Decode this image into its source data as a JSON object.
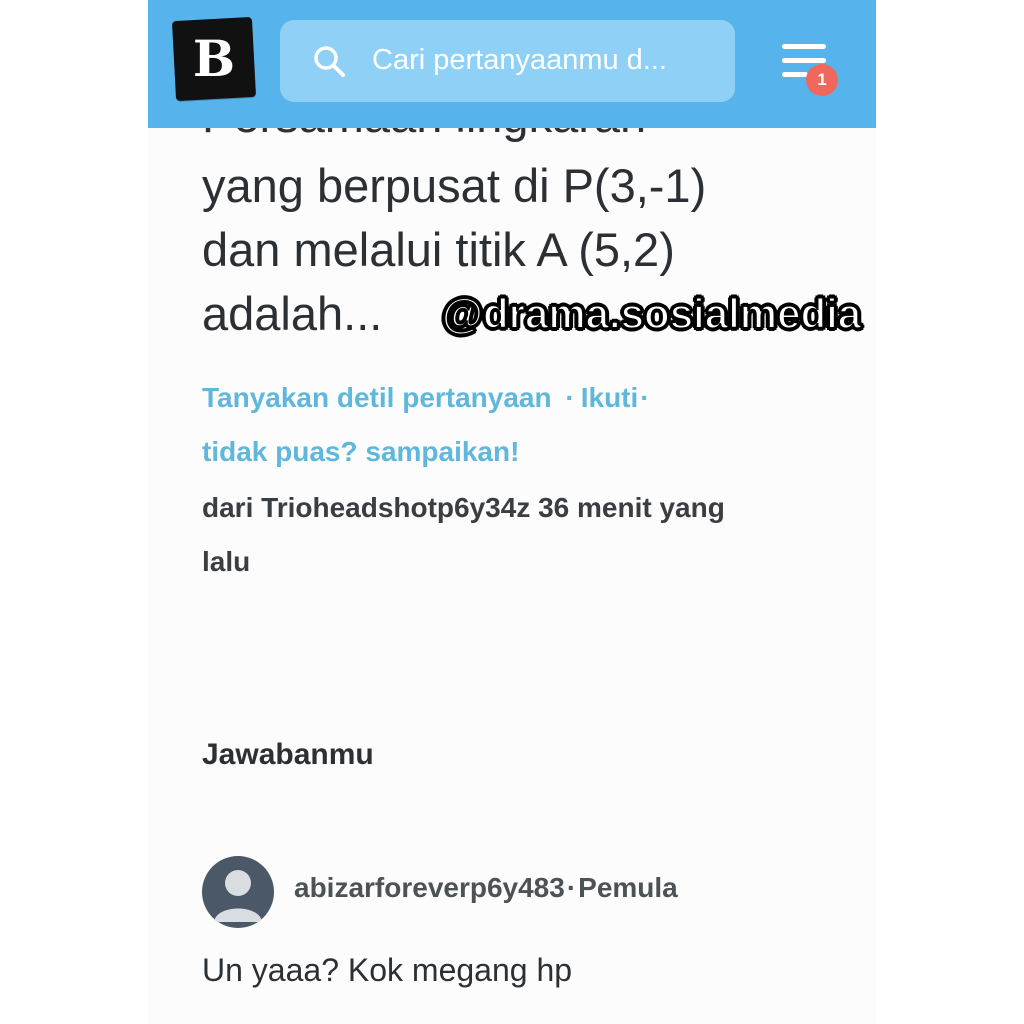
{
  "header": {
    "logo_letter": "B",
    "search_placeholder": "Cari pertanyaanmu d...",
    "notification_count": "1",
    "accent_color": "#56b3eb",
    "badge_color": "#f0675b",
    "icons": {
      "search": "search-icon",
      "menu": "menu-icon"
    }
  },
  "question": {
    "clipped_line": "Persamaan lingkaran",
    "lines": [
      "yang berpusat di P(3,-1)",
      "dan melalui titik A (5,2)",
      "adalah..."
    ]
  },
  "watermark": "@drama.sosialmedia",
  "actions": {
    "ask_detail": "Tanyakan detil pertanyaan",
    "follow": "Ikuti",
    "sep1": "·",
    "sep2": "·",
    "report": "tidak puas? sampaikan!"
  },
  "meta": {
    "line1": "dari Trioheadshotp6y34z 36 menit yang",
    "line2": "lalu"
  },
  "answer_section": {
    "title": "Jawabanmu",
    "user": "abizarforeverp6y483",
    "user_sep": "·",
    "rank": "Pemula",
    "text": "Un yaaa? Kok megang hp"
  }
}
